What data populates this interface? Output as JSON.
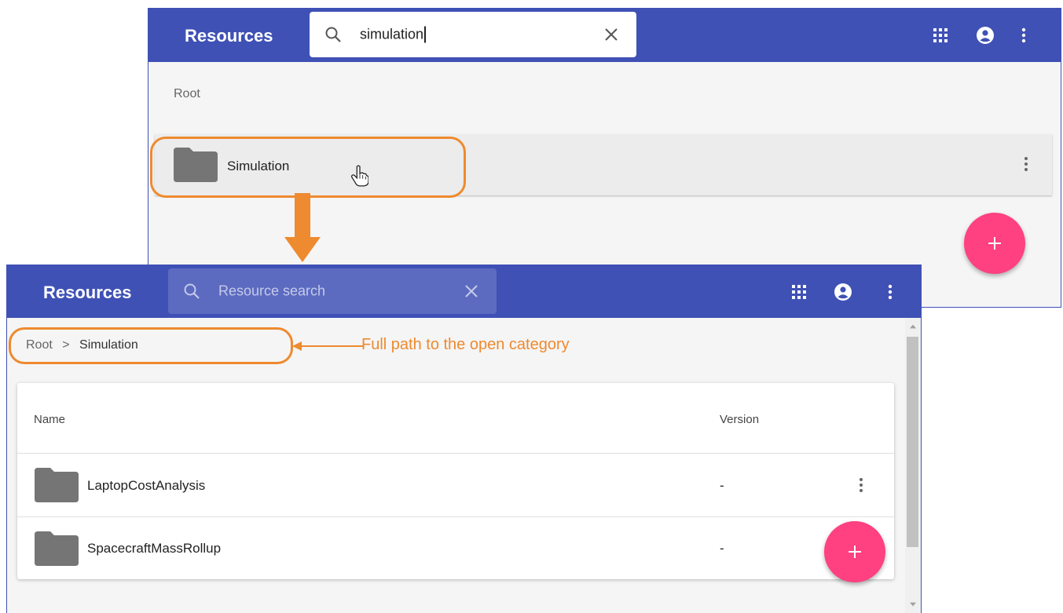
{
  "accent": "#3f51b5",
  "fab_color": "#ff4081",
  "callout_color": "#ee8a2f",
  "top_window": {
    "title": "Resources",
    "search": {
      "value": "simulation",
      "icons": [
        "search-icon",
        "close-icon"
      ]
    },
    "toolbar_icons": [
      "apps-grid-icon",
      "account-circle-icon",
      "more-vert-icon"
    ],
    "breadcrumb": "Root",
    "item": {
      "name": "Simulation",
      "icon": "folder-icon"
    },
    "fab_label": "+"
  },
  "bottom_window": {
    "title": "Resources",
    "search": {
      "placeholder": "Resource search",
      "icons": [
        "search-icon",
        "close-icon"
      ]
    },
    "toolbar_icons": [
      "apps-grid-icon",
      "account-circle-icon",
      "more-vert-icon"
    ],
    "breadcrumb": {
      "root": "Root",
      "separator": ">",
      "current": "Simulation"
    },
    "table": {
      "columns": [
        "Name",
        "Version"
      ],
      "rows": [
        {
          "name": "LaptopCostAnalysis",
          "version": "-",
          "icon": "folder-icon"
        },
        {
          "name": "SpacecraftMassRollup",
          "version": "-",
          "icon": "folder-icon"
        }
      ]
    },
    "fab_label": "+"
  },
  "annotation": {
    "text": "Full path to the open category"
  }
}
